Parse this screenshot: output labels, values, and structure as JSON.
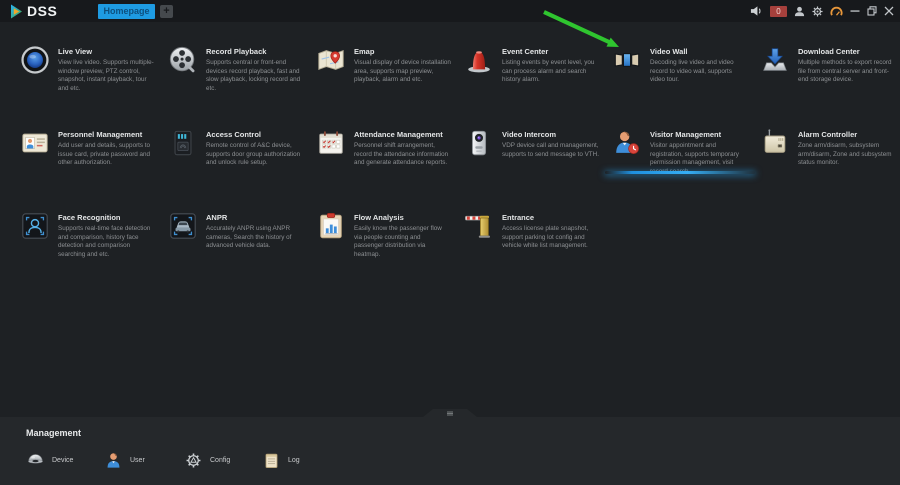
{
  "titlebar": {
    "logo_text": "DSS",
    "tabs": [
      {
        "label": "Homepage",
        "active": true
      }
    ],
    "add_tab_label": "+",
    "alarm_badge_count": "0",
    "icons": [
      "speaker-icon",
      "alarm-count-badge",
      "user-icon",
      "settings-gear-icon",
      "net-gauge-icon",
      "minimize-icon",
      "restore-icon",
      "close-icon"
    ]
  },
  "modules": {
    "items": [
      {
        "title": "Live View",
        "icon": "camera-lens-icon",
        "desc": "View live video. Supports multiple-window preview, PTZ control, snapshot, instant playback, tour and etc."
      },
      {
        "title": "Record Playback",
        "icon": "film-reel-icon",
        "desc": "Supports central or front-end devices record playback, fast and slow playback, locking record and etc."
      },
      {
        "title": "Emap",
        "icon": "map-pin-icon",
        "desc": "Visual display of device installation area, supports map preview, playback, alarm and etc."
      },
      {
        "title": "Event Center",
        "icon": "alarm-siren-icon",
        "desc": "Listing events by event level, you can process alarm and search history alarm."
      },
      {
        "title": "Video Wall",
        "icon": "video-wall-icon",
        "desc": "Decoding live video and video record to video wall, supports video tour."
      },
      {
        "title": "Download Center",
        "icon": "download-tray-icon",
        "desc": "Multiple methods to export record file from central server and front-end storage device."
      },
      {
        "title": "Personnel Management",
        "icon": "id-card-icon",
        "desc": "Add user and details, supports to issue card, private password and other authorization."
      },
      {
        "title": "Access Control",
        "icon": "access-reader-icon",
        "desc": "Remote control of A&C device, supports door group authorization and unlock rule setup."
      },
      {
        "title": "Attendance Management",
        "icon": "calendar-checks-icon",
        "desc": "Personnel shift arrangement, record the attendance information and generate attendance reports."
      },
      {
        "title": "Video Intercom",
        "icon": "door-station-icon",
        "desc": "VDP device call and management, supports to send message to VTH."
      },
      {
        "title": "Visitor Management",
        "icon": "visitor-clock-icon",
        "desc": "Visitor appointment and registration, supports temporary permission management, visit record search.",
        "highlighted": true
      },
      {
        "title": "Alarm Controller",
        "icon": "alarm-box-icon",
        "desc": "Zone arm/disarm, subsystem arm/disarm, Zone and subsystem status monitor."
      },
      {
        "title": "Face Recognition",
        "icon": "face-scan-icon",
        "desc": "Supports real-time face detection and comparison, history face detection and comparison searching and etc."
      },
      {
        "title": "ANPR",
        "icon": "plate-camera-icon",
        "desc": "Accurately ANPR using ANPR cameras, Search the history of advanced vehicle data."
      },
      {
        "title": "Flow Analysis",
        "icon": "clipboard-chart-icon",
        "desc": "Easily know the passenger flow via people counting and passenger distribution via heatmap."
      },
      {
        "title": "Entrance",
        "icon": "parking-barrier-icon",
        "desc": "Access license plate snapshot, support parking lot config and vehicle white list management."
      }
    ]
  },
  "management": {
    "label": "Management",
    "items": [
      {
        "label": "Device",
        "icon": "dome-camera-icon"
      },
      {
        "label": "User",
        "icon": "user-icon"
      },
      {
        "label": "Config",
        "icon": "config-gear-icon"
      },
      {
        "label": "Log",
        "icon": "log-notebook-icon"
      }
    ]
  },
  "annotation": {
    "type": "arrow",
    "color": "#2fc52f",
    "points_to": "Video Wall"
  },
  "colors": {
    "titlebar_bg": "#17191c",
    "content_bg": "#1e2124",
    "panel_bg": "#25282b",
    "tab_blue": "#1e9be2",
    "badge_red": "#a6403c",
    "highlight_blue": "#2aa0e8",
    "arrow_green": "#2fc52f"
  }
}
